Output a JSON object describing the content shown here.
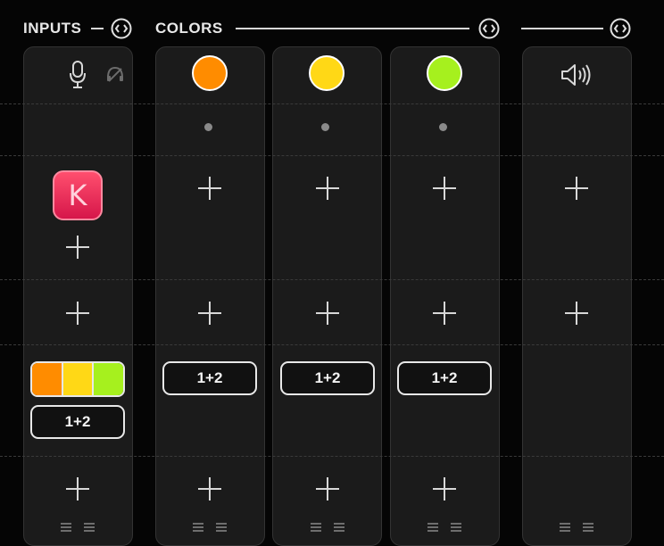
{
  "header": {
    "inputs_title": "INPUTS",
    "colors_title": "COLORS"
  },
  "inputs_strip": {
    "icons": [
      "microphone-icon",
      "headphones-icon"
    ],
    "badge_letter": "K",
    "badge_color": "#e8244f",
    "mix_colors": [
      "#ff8c00",
      "#ffd816",
      "#a6f01e"
    ],
    "route_label": "1+2"
  },
  "color_strips": [
    {
      "color": "#ff8c00",
      "route_label": "1+2"
    },
    {
      "color": "#ffd816",
      "route_label": "1+2"
    },
    {
      "color": "#a6f01e",
      "route_label": "1+2"
    }
  ],
  "output_strip": {
    "icon": "speaker-icon"
  }
}
